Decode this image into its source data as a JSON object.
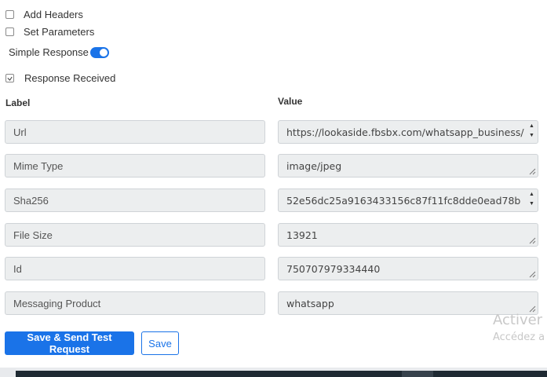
{
  "options": {
    "add_headers": {
      "label": "Add Headers",
      "checked": false
    },
    "set_parameters": {
      "label": "Set Parameters",
      "checked": false
    },
    "simple_response": {
      "label": "Simple Response",
      "enabled": true
    },
    "response_received": {
      "label": "Response Received",
      "checked": true
    }
  },
  "columns": {
    "label": "Label",
    "value": "Value"
  },
  "rows": [
    {
      "label": "Url",
      "value": "https://lookaside.fbsbx.com/whatsapp_business/"
    },
    {
      "label": "Mime Type",
      "value": "image/jpeg"
    },
    {
      "label": "Sha256",
      "value": "52e56dc25a9163433156c87f11fc8dde0ead78b"
    },
    {
      "label": "File Size",
      "value": "13921"
    },
    {
      "label": "Id",
      "value": "750707979334440"
    },
    {
      "label": "Messaging Product",
      "value": "whatsapp"
    }
  ],
  "buttons": {
    "save_send": "Save & Send Test Request",
    "save": "Save"
  },
  "watermark": {
    "line1": "Activer W",
    "line2": "Accédez a"
  },
  "colors": {
    "accent": "#1a73e8",
    "field_bg": "#eceeef",
    "field_border": "#cfd3d7"
  }
}
